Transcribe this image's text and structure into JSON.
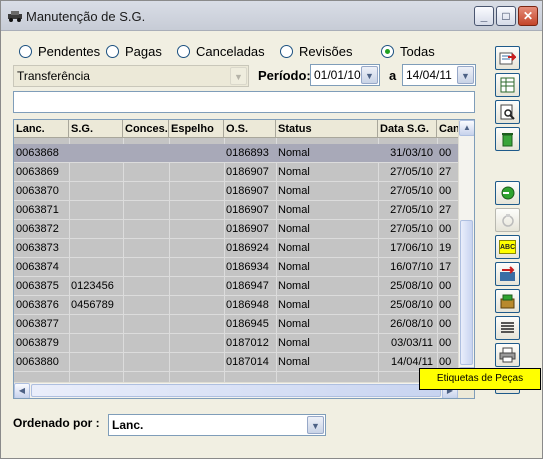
{
  "window": {
    "title": "Manutenção de S.G.",
    "controls": {
      "minimize": "_",
      "maximize": "□",
      "close": "✕"
    }
  },
  "filters": {
    "options": [
      "Pendentes",
      "Pagas",
      "Canceladas",
      "Revisões",
      "Todas"
    ],
    "selected": "Todas"
  },
  "type_combo": {
    "value": "Transferência"
  },
  "period": {
    "label": "Período:",
    "from": "01/01/10",
    "to_label": "a",
    "to": "14/04/11"
  },
  "search_text": "",
  "table": {
    "columns": [
      "Lanc.",
      "S.G.",
      "Conces.",
      "Espelho",
      "O.S.",
      "Status",
      "Data S.G.",
      "Can"
    ],
    "rows": [
      [
        "0063868",
        "",
        "",
        "",
        "0186893",
        "Nomal",
        "31/03/10",
        "00"
      ],
      [
        "0063869",
        "",
        "",
        "",
        "0186907",
        "Nomal",
        "27/05/10",
        "27"
      ],
      [
        "0063870",
        "",
        "",
        "",
        "0186907",
        "Nomal",
        "27/05/10",
        "00"
      ],
      [
        "0063871",
        "",
        "",
        "",
        "0186907",
        "Nomal",
        "27/05/10",
        "27"
      ],
      [
        "0063872",
        "",
        "",
        "",
        "0186907",
        "Nomal",
        "27/05/10",
        "00"
      ],
      [
        "0063873",
        "",
        "",
        "",
        "0186924",
        "Nomal",
        "17/06/10",
        "19"
      ],
      [
        "0063874",
        "",
        "",
        "",
        "0186934",
        "Nomal",
        "16/07/10",
        "17"
      ],
      [
        "0063875",
        "0123456",
        "",
        "",
        "0186947",
        "Nomal",
        "25/08/10",
        "00"
      ],
      [
        "0063876",
        "0456789",
        "",
        "",
        "0186948",
        "Nomal",
        "25/08/10",
        "00"
      ],
      [
        "0063877",
        "",
        "",
        "",
        "0186945",
        "Nomal",
        "26/08/10",
        "00"
      ],
      [
        "0063879",
        "",
        "",
        "",
        "0187012",
        "Nomal",
        "03/03/11",
        "00"
      ],
      [
        "0063880",
        "",
        "",
        "",
        "0187014",
        "Nomal",
        "14/04/11",
        "00"
      ]
    ],
    "selected_row": 0
  },
  "sort": {
    "label": "Ordenado por :",
    "value": "Lanc."
  },
  "toolbar": {
    "buttons": [
      "export-icon",
      "spreadsheet-icon",
      "preview-icon",
      "trash-icon",
      "go-icon",
      "disabled-icon",
      "abc-icon",
      "swap-icon",
      "box-icon",
      "list-icon",
      "printer-icon",
      "exit-icon"
    ],
    "abc_text": "ABC"
  },
  "tooltip": "Etiquetas de Peças",
  "colors": {
    "selected_row": "#a8a9b8",
    "grid_bg": "#c4c4c4",
    "tooltip_bg": "#ffff00"
  }
}
